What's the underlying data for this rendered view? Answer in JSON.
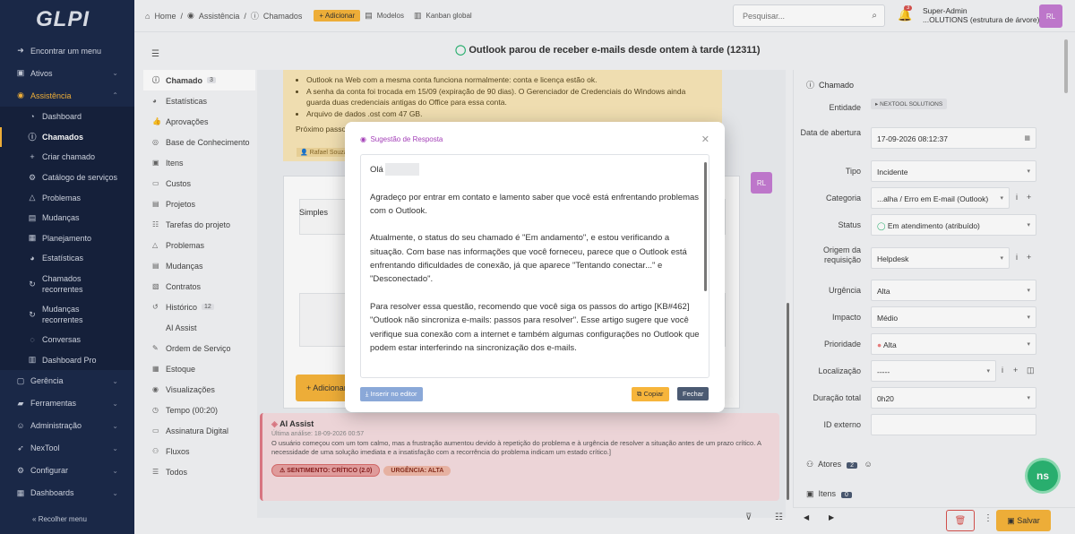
{
  "sidebar": {
    "logo": "GLPI",
    "items": [
      {
        "label": "Encontrar um menu",
        "icon": "arrow-right-icon"
      },
      {
        "label": "Ativos",
        "icon": "box-icon"
      },
      {
        "label": "Assistência",
        "icon": "lifebuoy-icon"
      },
      {
        "label": "Gerência",
        "icon": "wallet-icon"
      },
      {
        "label": "Ferramentas",
        "icon": "briefcase-icon"
      },
      {
        "label": "Administração",
        "icon": "users-icon"
      },
      {
        "label": "NexTool",
        "icon": "rocket-icon"
      },
      {
        "label": "Configurar",
        "icon": "gear-icon"
      },
      {
        "label": "Dashboards",
        "icon": "dashboard-icon"
      }
    ],
    "sub": [
      {
        "label": "Dashboard"
      },
      {
        "label": "Chamados"
      },
      {
        "label": "Criar chamado"
      },
      {
        "label": "Catálogo de serviços"
      },
      {
        "label": "Problemas"
      },
      {
        "label": "Mudanças"
      },
      {
        "label": "Planejamento"
      },
      {
        "label": "Estatísticas"
      },
      {
        "label": "Chamados recorrentes"
      },
      {
        "label": "Mudanças recorrentes"
      },
      {
        "label": "Conversas"
      },
      {
        "label": "Dashboard Pro"
      }
    ],
    "collapse": "Recolher menu"
  },
  "topbar": {
    "home": "Home",
    "assist": "Assistência",
    "chamados": "Chamados",
    "add": "Adicionar",
    "models": "Modelos",
    "kanban": "Kanban global",
    "search_placeholder": "Pesquisar...",
    "notif_count": "3",
    "user_name": "Super-Admin",
    "user_entity": "...OLUTIONS (estrutura de árvore)",
    "avatar": "RL"
  },
  "ticket_title": "Outlook parou de receber e-mails desde ontem à tarde (12311)",
  "tabs": [
    {
      "label": "Chamado",
      "count": "3"
    },
    {
      "label": "Estatísticas"
    },
    {
      "label": "Aprovações"
    },
    {
      "label": "Base de Conhecimento"
    },
    {
      "label": "Itens"
    },
    {
      "label": "Custos"
    },
    {
      "label": "Projetos"
    },
    {
      "label": "Tarefas do projeto"
    },
    {
      "label": "Problemas"
    },
    {
      "label": "Mudanças"
    },
    {
      "label": "Contratos"
    },
    {
      "label": "Histórico",
      "count": "12"
    },
    {
      "label": "AI Assist"
    },
    {
      "label": "Ordem de Serviço"
    },
    {
      "label": "Estoque"
    },
    {
      "label": "Visualizações"
    },
    {
      "label": "Tempo (00:20)"
    },
    {
      "label": "Assinatura Digital"
    },
    {
      "label": "Fluxos"
    },
    {
      "label": "Todos"
    }
  ],
  "warn": {
    "bullets": [
      "Outlook na Web com a mesma conta funciona normalmente: conta e licença estão ok.",
      "A senha da conta foi trocada em 15/09 (expiração de 90 dias). O Gerenciador de Credenciais do Windows ainda guarda duas credenciais antigas do Office para essa conta.",
      "Arquivo de dados .ost com 47 GB."
    ],
    "proximo": "Próximo passo",
    "author": "Rafael Souza"
  },
  "editor": {
    "simples": "Simples",
    "add": "Adicionar",
    "rl": "RL"
  },
  "ai": {
    "title": "AI Assist",
    "date": "Última análise: 18-09-2026 00:57",
    "text": "O usuário começou com um tom calmo, mas a frustração aumentou devido à repetição do problema e à urgência de resolver a situação antes de um prazo crítico. A necessidade de uma solução imediata e a insatisfação com a recorrência do problema indicam um estado crítico.]",
    "sentiment": "SENTIMENTO: CRÍTICO (2.0)",
    "urgency": "URGÊNCIA: ALTA"
  },
  "right": {
    "header": "Chamado",
    "entity_label": "Entidade",
    "entity": "NEXTOOL SOLUTIONS",
    "fields": [
      {
        "label": "Data de abertura",
        "value": "17-09-2026 08:12:37"
      },
      {
        "label": "Tipo",
        "value": "Incidente"
      },
      {
        "label": "Categoria",
        "value": "...alha / Erro em E-mail (Outlook)"
      },
      {
        "label": "Status",
        "value": "Em atendimento (atribuído)"
      },
      {
        "label": "Origem da requisição",
        "value": "Helpdesk"
      },
      {
        "label": "Urgência",
        "value": "Alta"
      },
      {
        "label": "Impacto",
        "value": "Médio"
      },
      {
        "label": "Prioridade",
        "value": "Alta"
      },
      {
        "label": "Localização",
        "value": "-----"
      },
      {
        "label": "Duração total",
        "value": "0h20"
      },
      {
        "label": "ID externo",
        "value": ""
      }
    ],
    "atores": "Atores",
    "atores_count": "2",
    "itens": "Itens",
    "itens_count": "0",
    "save": "Salvar"
  },
  "modal": {
    "title": "Sugestão de Resposta",
    "greeting": "Olá",
    "p1": "Agradeço por entrar em contato e lamento saber que você está enfrentando problemas com o Outlook.",
    "p2": "Atualmente, o status do seu chamado é \"Em andamento\", e estou verificando a situação. Com base nas informações que você forneceu, parece que o Outlook está enfrentando dificuldades de conexão, já que aparece \"Tentando conectar...\" e \"Desconectado\".",
    "p3": "Para resolver essa questão, recomendo que você siga os passos do artigo [KB#462] \"Outlook não sincroniza e-mails: passos para resolver\". Esse artigo sugere que você verifique sua conexão com a internet e também algumas configurações no Outlook que podem estar interferindo na sincronização dos e-mails.",
    "insert": "Inserir no editor",
    "copy": "Copiar",
    "close": "Fechar"
  }
}
